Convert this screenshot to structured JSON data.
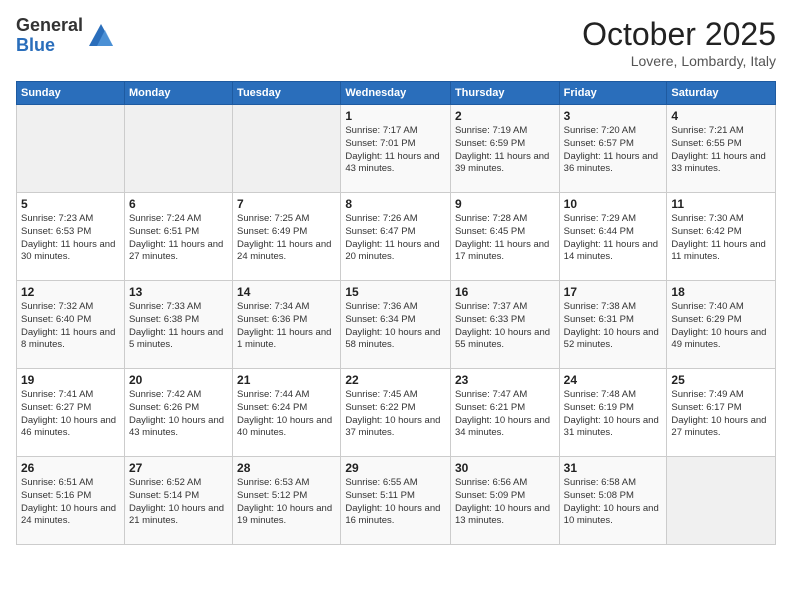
{
  "logo": {
    "general": "General",
    "blue": "Blue"
  },
  "title": "October 2025",
  "location": "Lovere, Lombardy, Italy",
  "days_of_week": [
    "Sunday",
    "Monday",
    "Tuesday",
    "Wednesday",
    "Thursday",
    "Friday",
    "Saturday"
  ],
  "weeks": [
    [
      {
        "day": "",
        "info": ""
      },
      {
        "day": "",
        "info": ""
      },
      {
        "day": "",
        "info": ""
      },
      {
        "day": "1",
        "info": "Sunrise: 7:17 AM\nSunset: 7:01 PM\nDaylight: 11 hours and 43 minutes."
      },
      {
        "day": "2",
        "info": "Sunrise: 7:19 AM\nSunset: 6:59 PM\nDaylight: 11 hours and 39 minutes."
      },
      {
        "day": "3",
        "info": "Sunrise: 7:20 AM\nSunset: 6:57 PM\nDaylight: 11 hours and 36 minutes."
      },
      {
        "day": "4",
        "info": "Sunrise: 7:21 AM\nSunset: 6:55 PM\nDaylight: 11 hours and 33 minutes."
      }
    ],
    [
      {
        "day": "5",
        "info": "Sunrise: 7:23 AM\nSunset: 6:53 PM\nDaylight: 11 hours and 30 minutes."
      },
      {
        "day": "6",
        "info": "Sunrise: 7:24 AM\nSunset: 6:51 PM\nDaylight: 11 hours and 27 minutes."
      },
      {
        "day": "7",
        "info": "Sunrise: 7:25 AM\nSunset: 6:49 PM\nDaylight: 11 hours and 24 minutes."
      },
      {
        "day": "8",
        "info": "Sunrise: 7:26 AM\nSunset: 6:47 PM\nDaylight: 11 hours and 20 minutes."
      },
      {
        "day": "9",
        "info": "Sunrise: 7:28 AM\nSunset: 6:45 PM\nDaylight: 11 hours and 17 minutes."
      },
      {
        "day": "10",
        "info": "Sunrise: 7:29 AM\nSunset: 6:44 PM\nDaylight: 11 hours and 14 minutes."
      },
      {
        "day": "11",
        "info": "Sunrise: 7:30 AM\nSunset: 6:42 PM\nDaylight: 11 hours and 11 minutes."
      }
    ],
    [
      {
        "day": "12",
        "info": "Sunrise: 7:32 AM\nSunset: 6:40 PM\nDaylight: 11 hours and 8 minutes."
      },
      {
        "day": "13",
        "info": "Sunrise: 7:33 AM\nSunset: 6:38 PM\nDaylight: 11 hours and 5 minutes."
      },
      {
        "day": "14",
        "info": "Sunrise: 7:34 AM\nSunset: 6:36 PM\nDaylight: 11 hours and 1 minute."
      },
      {
        "day": "15",
        "info": "Sunrise: 7:36 AM\nSunset: 6:34 PM\nDaylight: 10 hours and 58 minutes."
      },
      {
        "day": "16",
        "info": "Sunrise: 7:37 AM\nSunset: 6:33 PM\nDaylight: 10 hours and 55 minutes."
      },
      {
        "day": "17",
        "info": "Sunrise: 7:38 AM\nSunset: 6:31 PM\nDaylight: 10 hours and 52 minutes."
      },
      {
        "day": "18",
        "info": "Sunrise: 7:40 AM\nSunset: 6:29 PM\nDaylight: 10 hours and 49 minutes."
      }
    ],
    [
      {
        "day": "19",
        "info": "Sunrise: 7:41 AM\nSunset: 6:27 PM\nDaylight: 10 hours and 46 minutes."
      },
      {
        "day": "20",
        "info": "Sunrise: 7:42 AM\nSunset: 6:26 PM\nDaylight: 10 hours and 43 minutes."
      },
      {
        "day": "21",
        "info": "Sunrise: 7:44 AM\nSunset: 6:24 PM\nDaylight: 10 hours and 40 minutes."
      },
      {
        "day": "22",
        "info": "Sunrise: 7:45 AM\nSunset: 6:22 PM\nDaylight: 10 hours and 37 minutes."
      },
      {
        "day": "23",
        "info": "Sunrise: 7:47 AM\nSunset: 6:21 PM\nDaylight: 10 hours and 34 minutes."
      },
      {
        "day": "24",
        "info": "Sunrise: 7:48 AM\nSunset: 6:19 PM\nDaylight: 10 hours and 31 minutes."
      },
      {
        "day": "25",
        "info": "Sunrise: 7:49 AM\nSunset: 6:17 PM\nDaylight: 10 hours and 27 minutes."
      }
    ],
    [
      {
        "day": "26",
        "info": "Sunrise: 6:51 AM\nSunset: 5:16 PM\nDaylight: 10 hours and 24 minutes."
      },
      {
        "day": "27",
        "info": "Sunrise: 6:52 AM\nSunset: 5:14 PM\nDaylight: 10 hours and 21 minutes."
      },
      {
        "day": "28",
        "info": "Sunrise: 6:53 AM\nSunset: 5:12 PM\nDaylight: 10 hours and 19 minutes."
      },
      {
        "day": "29",
        "info": "Sunrise: 6:55 AM\nSunset: 5:11 PM\nDaylight: 10 hours and 16 minutes."
      },
      {
        "day": "30",
        "info": "Sunrise: 6:56 AM\nSunset: 5:09 PM\nDaylight: 10 hours and 13 minutes."
      },
      {
        "day": "31",
        "info": "Sunrise: 6:58 AM\nSunset: 5:08 PM\nDaylight: 10 hours and 10 minutes."
      },
      {
        "day": "",
        "info": ""
      }
    ]
  ]
}
